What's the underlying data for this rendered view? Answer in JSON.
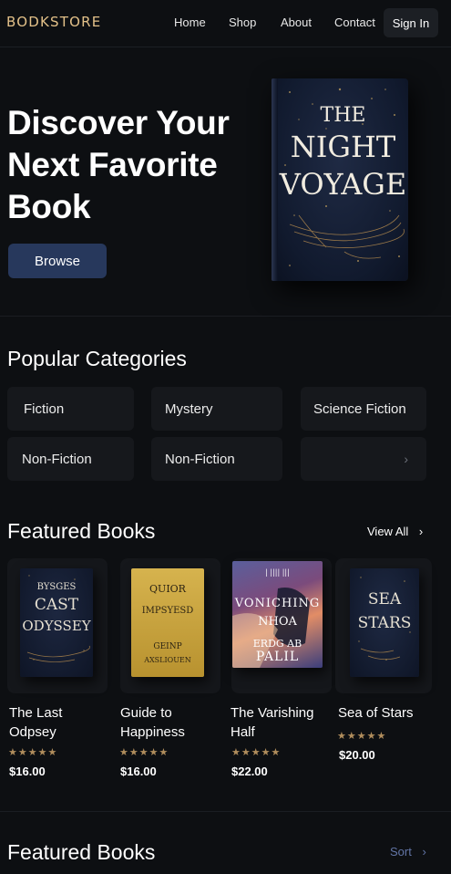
{
  "nav": {
    "brand": "BODKSTORE",
    "links": [
      "Home",
      "Shop",
      "About",
      "Contact"
    ],
    "sign_in": "Sign In"
  },
  "hero": {
    "title": "Discover Your Next Favorite Book",
    "browse_label": "Browse",
    "book": {
      "line1": "THE",
      "line2": "NIGHT",
      "line3": "VOYAGE"
    }
  },
  "categories": {
    "title": "Popular Categories",
    "items": [
      "Fiction",
      "Mystery",
      "Science Fiction",
      "Non-Fiction",
      "Non-Fiction"
    ],
    "more_icon": "chevron-right-icon"
  },
  "featured": {
    "title": "Featured Books",
    "view_all": "View All",
    "books": [
      {
        "title": "The Last Odpsey",
        "cover_lines": [
          "BYSGES",
          "CAST",
          "ODYSSEY"
        ],
        "rating": "★★★★★",
        "price": "$16.00"
      },
      {
        "title": "Guide to Happiness",
        "cover_lines": [
          "QUIOR",
          "IMPSYESD",
          "GEINP",
          "AXSLIOUEN"
        ],
        "rating": "★★★★★",
        "price": "$16.00"
      },
      {
        "title": "The Varishing Half",
        "cover_lines": [
          "VONICHING",
          "NHOA",
          "ERDG AB",
          "PALIL"
        ],
        "rating": "★★★★★",
        "price": "$22.00"
      },
      {
        "title": "Sea of Stars",
        "cover_lines": [
          "SEA",
          "STARS"
        ],
        "rating": "★★★★★",
        "price": "$20.00"
      }
    ]
  },
  "featured2": {
    "title": "Featured Books",
    "sort": "Sort"
  },
  "colors": {
    "background": "#0d0f12",
    "brand": "#e3c189",
    "button": "#27385c",
    "star": "#b08d5c",
    "link_muted": "#6275a6"
  }
}
